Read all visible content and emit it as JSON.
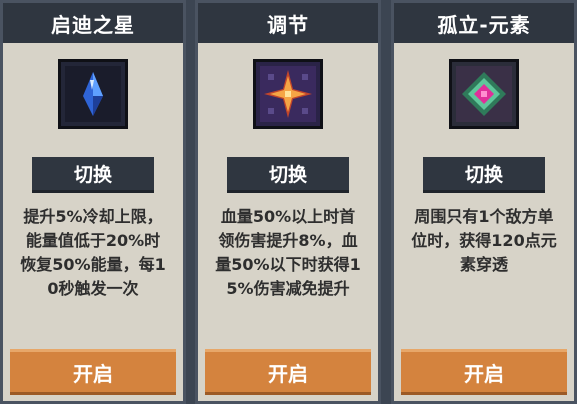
{
  "cards": [
    {
      "title": "启迪之星",
      "icon": "blue-crystal-icon",
      "switch_label": "切换",
      "desc_lines": [
        "提升5%冷却上限，",
        "能量值低于20%时",
        "恢复50%能量，每1",
        "0秒触发一次"
      ],
      "open_label": "开启"
    },
    {
      "title": "调节",
      "icon": "orange-star-icon",
      "switch_label": "切换",
      "desc_lines": [
        "血量50%以上时首",
        "领伤害提升8%，血",
        "量50%以下时获得1",
        "5%伤害减免提升"
      ],
      "open_label": "开启"
    },
    {
      "title": "孤立-元素",
      "icon": "green-pink-gem-icon",
      "switch_label": "切换",
      "desc_lines": [
        "周围只有1个敌方单",
        "位时，获得120点元",
        "素穿透"
      ],
      "open_label": "开启"
    }
  ],
  "colors": {
    "panel_bg": "#d7d3c8",
    "header_bg": "#2f3640",
    "open_button": "#d4833e"
  }
}
